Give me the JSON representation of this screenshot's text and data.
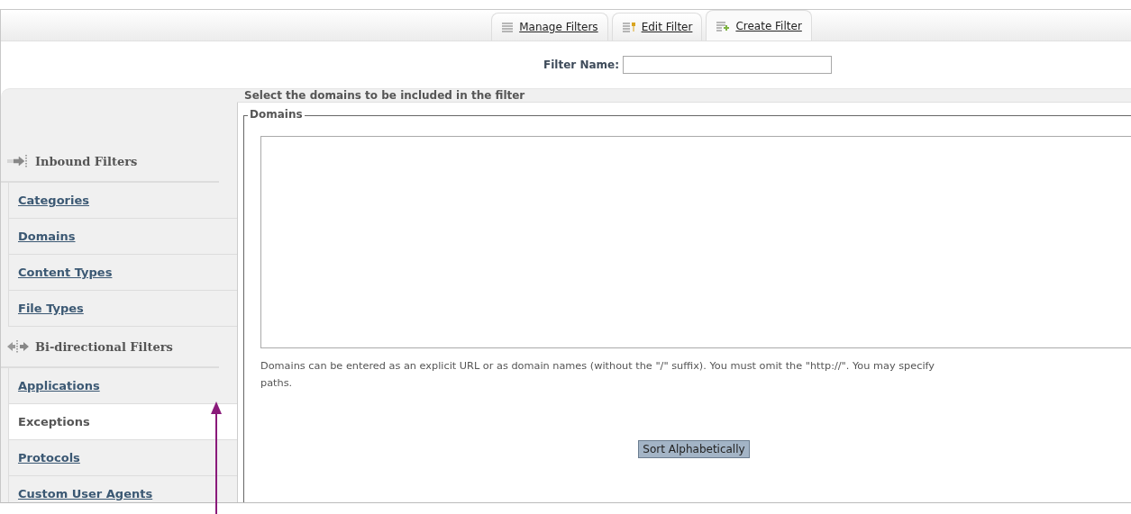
{
  "tabs": [
    {
      "label": "Manage Filters",
      "selected": false
    },
    {
      "label": "Edit Filter",
      "selected": false
    },
    {
      "label": "Create Filter",
      "selected": true
    }
  ],
  "filter_name": {
    "label": "Filter Name:"
  },
  "sidebar": {
    "groups": [
      {
        "title": "Inbound Filters",
        "items": [
          {
            "label": "Categories",
            "selected": false
          },
          {
            "label": "Domains",
            "selected": false
          },
          {
            "label": "Content Types",
            "selected": false
          },
          {
            "label": "File Types",
            "selected": false
          }
        ]
      },
      {
        "title": "Bi-directional Filters",
        "items": [
          {
            "label": "Applications",
            "selected": false
          },
          {
            "label": "Exceptions",
            "selected": true
          },
          {
            "label": "Protocols",
            "selected": false
          },
          {
            "label": "Custom User Agents",
            "selected": false
          }
        ]
      }
    ]
  },
  "content": {
    "heading": "Select the domains to be included in the filter",
    "fieldset": {
      "legend": "Domains",
      "help_lines": [
        "Domains can be entered as an explicit URL or as domain names (without the \"/\" suffix). You must omit the \"http://\". You may specify",
        "paths."
      ],
      "button": "Sort Alphabetically"
    }
  },
  "annotation": {
    "kind": "arrow"
  }
}
